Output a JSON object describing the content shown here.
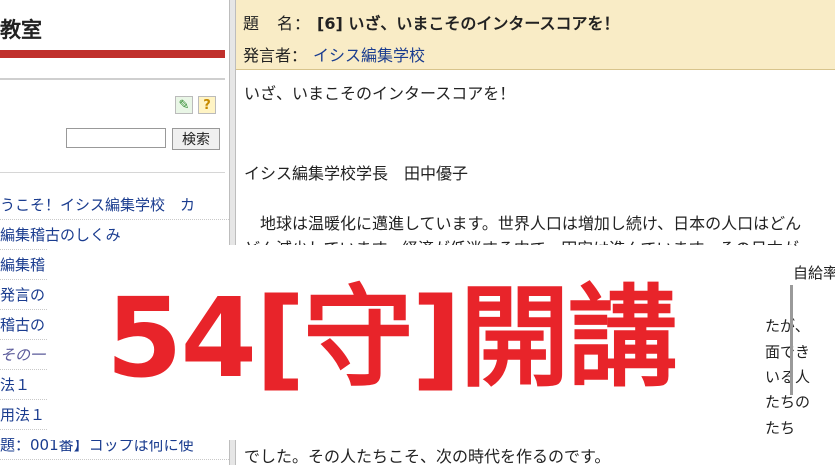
{
  "left": {
    "title": "教室",
    "search": {
      "value": "",
      "button_label": "検索"
    },
    "tools": {
      "edit_icon": "pencil-icon",
      "help_icon": "help-icon",
      "edit_glyph": "✎",
      "help_glyph": "?"
    },
    "nav": [
      {
        "label": "うこそ！イシス編集学校　カ"
      },
      {
        "label": "編集稽古のしくみ"
      },
      {
        "label": "編集稽"
      },
      {
        "label": "発言の"
      },
      {
        "label": "稽古の"
      },
      {
        "label": "その一"
      },
      {
        "label": "法１"
      },
      {
        "label": "用法１"
      },
      {
        "label": "題：001番】コップは何に使"
      }
    ]
  },
  "post": {
    "subject_label": "題　名：",
    "subject": "[6] いざ、いまこそのインタースコアを！",
    "author_label": "発言者：",
    "author": "イシス編集学校",
    "body": {
      "line1": "いざ、いまこそのインタースコアを！",
      "line2": "イシス編集学校学長　田中優子",
      "line3": "　地球は温暖化に邁進しています。世界人口は増加し続け、日本の人口はどん",
      "line4": "どん減少しています。経済が低迷する中で、円安は進んでいます。その日本が",
      "frag_a": "自給率",
      "frag_b": "たが、",
      "frag_c": "面でき",
      "frag_d": "いる人",
      "frag_e": "たちの",
      "frag_f": "たち",
      "line_last": "でした。その人たちこそ、次の時代を作るのです。"
    }
  },
  "banner": {
    "text": "54[守]開講"
  },
  "colors": {
    "accent_red": "#e8242a",
    "link_blue": "#1a3c8f",
    "header_bg": "#f9ecc6",
    "bar_red": "#c0302c"
  }
}
